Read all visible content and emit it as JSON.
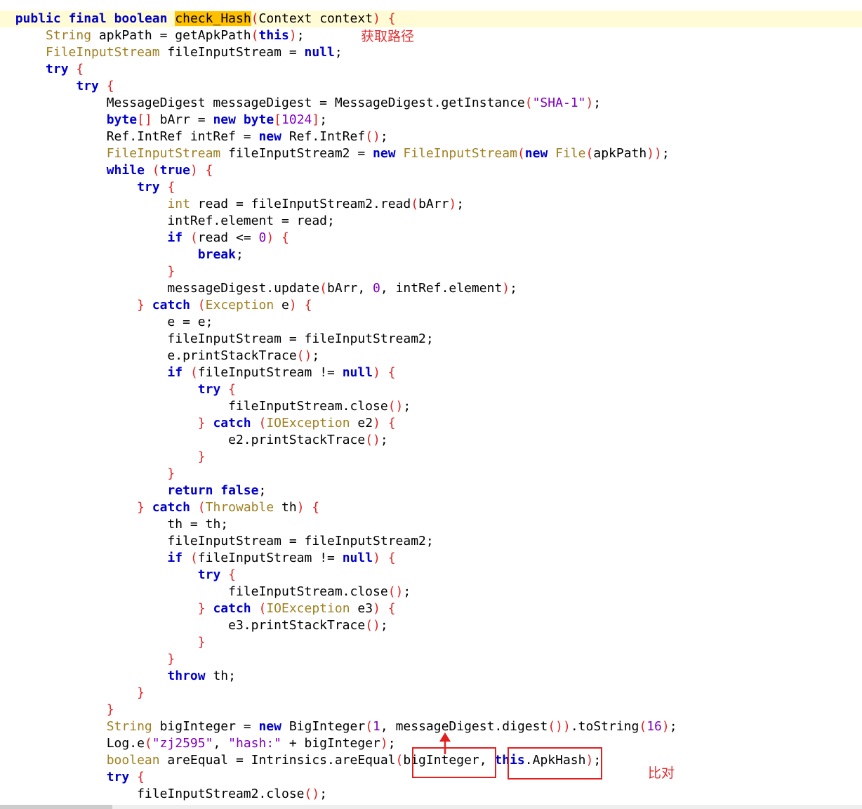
{
  "annotations": {
    "path_note": "获取路径",
    "compare_note": "比对"
  },
  "code": {
    "lines": [
      {
        "indent": "  ",
        "highlight": true,
        "tokens": [
          [
            "public",
            "kw"
          ],
          [
            " ",
            "p"
          ],
          [
            "final",
            "kw"
          ],
          [
            " ",
            "p"
          ],
          [
            "boolean",
            "kw"
          ],
          [
            " ",
            "p"
          ],
          [
            "check_Hash",
            "sel"
          ],
          [
            "(",
            "pn"
          ],
          [
            "Context context",
            "p"
          ],
          [
            ")",
            "pn"
          ],
          [
            " ",
            "p"
          ],
          [
            "{",
            "pn"
          ]
        ]
      },
      {
        "indent": "      ",
        "tokens": [
          [
            "String",
            "ty"
          ],
          [
            " apkPath = getApkPath",
            "p"
          ],
          [
            "(",
            "pn"
          ],
          [
            "this",
            "kw"
          ],
          [
            ")",
            "pn"
          ],
          [
            ";",
            "p"
          ]
        ]
      },
      {
        "indent": "      ",
        "tokens": [
          [
            "FileInputStream",
            "ty"
          ],
          [
            " fileInputStream = ",
            "p"
          ],
          [
            "null",
            "kw"
          ],
          [
            ";",
            "p"
          ]
        ]
      },
      {
        "indent": "      ",
        "tokens": [
          [
            "try",
            "kw"
          ],
          [
            " ",
            "p"
          ],
          [
            "{",
            "pn"
          ]
        ]
      },
      {
        "indent": "          ",
        "tokens": [
          [
            "try",
            "kw"
          ],
          [
            " ",
            "p"
          ],
          [
            "{",
            "pn"
          ]
        ]
      },
      {
        "indent": "              ",
        "tokens": [
          [
            "MessageDigest messageDigest = MessageDigest.getInstance",
            "p"
          ],
          [
            "(",
            "pn"
          ],
          [
            "\"SHA-1\"",
            "st"
          ],
          [
            ")",
            "pn"
          ],
          [
            ";",
            "p"
          ]
        ]
      },
      {
        "indent": "              ",
        "tokens": [
          [
            "byte",
            "kw"
          ],
          [
            "[]",
            "pn"
          ],
          [
            " bArr = ",
            "p"
          ],
          [
            "new",
            "kw"
          ],
          [
            " ",
            "p"
          ],
          [
            "byte",
            "kw"
          ],
          [
            "[",
            "pn"
          ],
          [
            "1024",
            "nm"
          ],
          [
            "]",
            "pn"
          ],
          [
            ";",
            "p"
          ]
        ]
      },
      {
        "indent": "              ",
        "tokens": [
          [
            "Ref.IntRef intRef = ",
            "p"
          ],
          [
            "new",
            "kw"
          ],
          [
            " Ref.IntRef",
            "p"
          ],
          [
            "()",
            "pn"
          ],
          [
            ";",
            "p"
          ]
        ]
      },
      {
        "indent": "              ",
        "tokens": [
          [
            "FileInputStream",
            "ty"
          ],
          [
            " fileInputStream2 = ",
            "p"
          ],
          [
            "new",
            "kw"
          ],
          [
            " ",
            "p"
          ],
          [
            "FileInputStream",
            "ty"
          ],
          [
            "(",
            "pn"
          ],
          [
            "new",
            "kw"
          ],
          [
            " ",
            "p"
          ],
          [
            "File",
            "ty"
          ],
          [
            "(",
            "pn"
          ],
          [
            "apkPath",
            "p"
          ],
          [
            "))",
            "pn"
          ],
          [
            ";",
            "p"
          ]
        ]
      },
      {
        "indent": "              ",
        "tokens": [
          [
            "while",
            "kw"
          ],
          [
            " ",
            "p"
          ],
          [
            "(",
            "pn"
          ],
          [
            "true",
            "kw"
          ],
          [
            ")",
            "pn"
          ],
          [
            " ",
            "p"
          ],
          [
            "{",
            "pn"
          ]
        ]
      },
      {
        "indent": "                  ",
        "tokens": [
          [
            "try",
            "kw"
          ],
          [
            " ",
            "p"
          ],
          [
            "{",
            "pn"
          ]
        ]
      },
      {
        "indent": "                      ",
        "tokens": [
          [
            "int",
            "ty"
          ],
          [
            " read = fileInputStream2.read",
            "p"
          ],
          [
            "(",
            "pn"
          ],
          [
            "bArr",
            "p"
          ],
          [
            ")",
            "pn"
          ],
          [
            ";",
            "p"
          ]
        ]
      },
      {
        "indent": "                      ",
        "tokens": [
          [
            "intRef.element = read;",
            "p"
          ]
        ]
      },
      {
        "indent": "                      ",
        "tokens": [
          [
            "if",
            "kw"
          ],
          [
            " ",
            "p"
          ],
          [
            "(",
            "pn"
          ],
          [
            "read <= ",
            "p"
          ],
          [
            "0",
            "nm"
          ],
          [
            ")",
            "pn"
          ],
          [
            " ",
            "p"
          ],
          [
            "{",
            "pn"
          ]
        ]
      },
      {
        "indent": "                          ",
        "tokens": [
          [
            "break",
            "kw"
          ],
          [
            ";",
            "p"
          ]
        ]
      },
      {
        "indent": "                      ",
        "tokens": [
          [
            "}",
            "pn"
          ]
        ]
      },
      {
        "indent": "                      ",
        "tokens": [
          [
            "messageDigest.update",
            "p"
          ],
          [
            "(",
            "pn"
          ],
          [
            "bArr, ",
            "p"
          ],
          [
            "0",
            "nm"
          ],
          [
            ", intRef.element",
            "p"
          ],
          [
            ")",
            "pn"
          ],
          [
            ";",
            "p"
          ]
        ]
      },
      {
        "indent": "                  ",
        "tokens": [
          [
            "}",
            "pn"
          ],
          [
            " ",
            "p"
          ],
          [
            "catch",
            "kw"
          ],
          [
            " ",
            "p"
          ],
          [
            "(",
            "pn"
          ],
          [
            "Exception",
            "ty"
          ],
          [
            " e",
            "p"
          ],
          [
            ")",
            "pn"
          ],
          [
            " ",
            "p"
          ],
          [
            "{",
            "pn"
          ]
        ]
      },
      {
        "indent": "                      ",
        "tokens": [
          [
            "e = e;",
            "p"
          ]
        ]
      },
      {
        "indent": "                      ",
        "tokens": [
          [
            "fileInputStream = fileInputStream2;",
            "p"
          ]
        ]
      },
      {
        "indent": "                      ",
        "tokens": [
          [
            "e.printStackTrace",
            "p"
          ],
          [
            "()",
            "pn"
          ],
          [
            ";",
            "p"
          ]
        ]
      },
      {
        "indent": "                      ",
        "tokens": [
          [
            "if",
            "kw"
          ],
          [
            " ",
            "p"
          ],
          [
            "(",
            "pn"
          ],
          [
            "fileInputStream != ",
            "p"
          ],
          [
            "null",
            "kw"
          ],
          [
            ")",
            "pn"
          ],
          [
            " ",
            "p"
          ],
          [
            "{",
            "pn"
          ]
        ]
      },
      {
        "indent": "                          ",
        "tokens": [
          [
            "try",
            "kw"
          ],
          [
            " ",
            "p"
          ],
          [
            "{",
            "pn"
          ]
        ]
      },
      {
        "indent": "                              ",
        "tokens": [
          [
            "fileInputStream.close",
            "p"
          ],
          [
            "()",
            "pn"
          ],
          [
            ";",
            "p"
          ]
        ]
      },
      {
        "indent": "                          ",
        "tokens": [
          [
            "}",
            "pn"
          ],
          [
            " ",
            "p"
          ],
          [
            "catch",
            "kw"
          ],
          [
            " ",
            "p"
          ],
          [
            "(",
            "pn"
          ],
          [
            "IOException",
            "ty"
          ],
          [
            " e2",
            "p"
          ],
          [
            ")",
            "pn"
          ],
          [
            " ",
            "p"
          ],
          [
            "{",
            "pn"
          ]
        ]
      },
      {
        "indent": "                              ",
        "tokens": [
          [
            "e2.printStackTrace",
            "p"
          ],
          [
            "()",
            "pn"
          ],
          [
            ";",
            "p"
          ]
        ]
      },
      {
        "indent": "                          ",
        "tokens": [
          [
            "}",
            "pn"
          ]
        ]
      },
      {
        "indent": "                      ",
        "tokens": [
          [
            "}",
            "pn"
          ]
        ]
      },
      {
        "indent": "                      ",
        "tokens": [
          [
            "return",
            "kw"
          ],
          [
            " ",
            "p"
          ],
          [
            "false",
            "kw"
          ],
          [
            ";",
            "p"
          ]
        ]
      },
      {
        "indent": "                  ",
        "tokens": [
          [
            "}",
            "pn"
          ],
          [
            " ",
            "p"
          ],
          [
            "catch",
            "kw"
          ],
          [
            " ",
            "p"
          ],
          [
            "(",
            "pn"
          ],
          [
            "Throwable",
            "ty"
          ],
          [
            " th",
            "p"
          ],
          [
            ")",
            "pn"
          ],
          [
            " ",
            "p"
          ],
          [
            "{",
            "pn"
          ]
        ]
      },
      {
        "indent": "                      ",
        "tokens": [
          [
            "th = th;",
            "p"
          ]
        ]
      },
      {
        "indent": "                      ",
        "tokens": [
          [
            "fileInputStream = fileInputStream2;",
            "p"
          ]
        ]
      },
      {
        "indent": "                      ",
        "tokens": [
          [
            "if",
            "kw"
          ],
          [
            " ",
            "p"
          ],
          [
            "(",
            "pn"
          ],
          [
            "fileInputStream != ",
            "p"
          ],
          [
            "null",
            "kw"
          ],
          [
            ")",
            "pn"
          ],
          [
            " ",
            "p"
          ],
          [
            "{",
            "pn"
          ]
        ]
      },
      {
        "indent": "                          ",
        "tokens": [
          [
            "try",
            "kw"
          ],
          [
            " ",
            "p"
          ],
          [
            "{",
            "pn"
          ]
        ]
      },
      {
        "indent": "                              ",
        "tokens": [
          [
            "fileInputStream.close",
            "p"
          ],
          [
            "()",
            "pn"
          ],
          [
            ";",
            "p"
          ]
        ]
      },
      {
        "indent": "                          ",
        "tokens": [
          [
            "}",
            "pn"
          ],
          [
            " ",
            "p"
          ],
          [
            "catch",
            "kw"
          ],
          [
            " ",
            "p"
          ],
          [
            "(",
            "pn"
          ],
          [
            "IOException",
            "ty"
          ],
          [
            " e3",
            "p"
          ],
          [
            ")",
            "pn"
          ],
          [
            " ",
            "p"
          ],
          [
            "{",
            "pn"
          ]
        ]
      },
      {
        "indent": "                              ",
        "tokens": [
          [
            "e3.printStackTrace",
            "p"
          ],
          [
            "()",
            "pn"
          ],
          [
            ";",
            "p"
          ]
        ]
      },
      {
        "indent": "                          ",
        "tokens": [
          [
            "}",
            "pn"
          ]
        ]
      },
      {
        "indent": "                      ",
        "tokens": [
          [
            "}",
            "pn"
          ]
        ]
      },
      {
        "indent": "                      ",
        "tokens": [
          [
            "throw",
            "kw"
          ],
          [
            " th;",
            "p"
          ]
        ]
      },
      {
        "indent": "                  ",
        "tokens": [
          [
            "}",
            "pn"
          ]
        ]
      },
      {
        "indent": "              ",
        "tokens": [
          [
            "}",
            "pn"
          ]
        ]
      },
      {
        "indent": "              ",
        "tokens": [
          [
            "String",
            "ty"
          ],
          [
            " bigInteger = ",
            "p"
          ],
          [
            "new",
            "kw"
          ],
          [
            " BigInteger",
            "p"
          ],
          [
            "(",
            "pn"
          ],
          [
            "1",
            "nm"
          ],
          [
            ", messageDigest.digest",
            "p"
          ],
          [
            "())",
            "pn"
          ],
          [
            ".toString",
            "p"
          ],
          [
            "(",
            "pn"
          ],
          [
            "16",
            "nm"
          ],
          [
            ")",
            "pn"
          ],
          [
            ";",
            "p"
          ]
        ]
      },
      {
        "indent": "              ",
        "tokens": [
          [
            "Log.e",
            "p"
          ],
          [
            "(",
            "pn"
          ],
          [
            "\"zj2595\"",
            "st"
          ],
          [
            ", ",
            "p"
          ],
          [
            "\"hash:\"",
            "st"
          ],
          [
            " + bigInteger",
            "p"
          ],
          [
            ")",
            "pn"
          ],
          [
            ";",
            "p"
          ]
        ]
      },
      {
        "indent": "              ",
        "tokens": [
          [
            "boolean",
            "ty"
          ],
          [
            " areEqual = Intrinsics.areEqual",
            "p"
          ],
          [
            "(",
            "pn"
          ],
          [
            "bigInteger, ",
            "p"
          ],
          [
            "this",
            "kw"
          ],
          [
            ".ApkHash",
            "p"
          ],
          [
            ")",
            "pn"
          ],
          [
            ";",
            "p"
          ]
        ]
      },
      {
        "indent": "              ",
        "tokens": [
          [
            "try",
            "kw"
          ],
          [
            " ",
            "p"
          ],
          [
            "{",
            "pn"
          ]
        ]
      },
      {
        "indent": "                  ",
        "tokens": [
          [
            "fileInputStream2.close",
            "p"
          ],
          [
            "()",
            "pn"
          ],
          [
            ";",
            "p"
          ]
        ]
      }
    ]
  }
}
